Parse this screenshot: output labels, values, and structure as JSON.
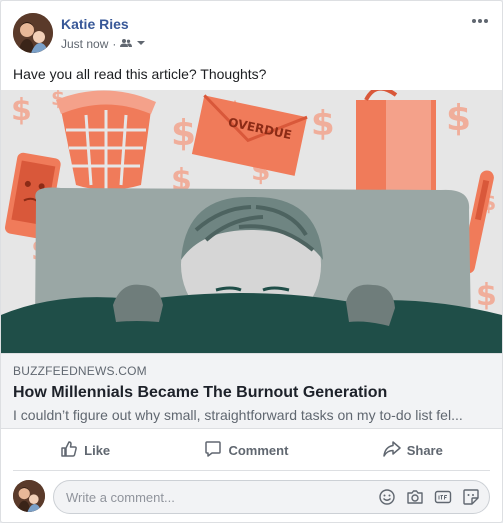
{
  "post": {
    "author": "Katie Ries",
    "timestamp": "Just now",
    "separator": "·",
    "audience_icon": "friends-icon",
    "text": "Have you all read this article? Thoughts?"
  },
  "illustration": {
    "overdue_label": "OVERDUE"
  },
  "link": {
    "domain": "BUZZFEEDNEWS.COM",
    "title": "How Millennials Became The Burnout Generation",
    "description": "I couldn’t figure out why small, straightforward tasks on my to-do list fel..."
  },
  "actions": {
    "like": "Like",
    "comment": "Comment",
    "share": "Share"
  },
  "comment_box": {
    "placeholder": "Write a comment...",
    "icons": [
      "emoji-icon",
      "camera-icon",
      "gif-icon",
      "sticker-icon"
    ]
  },
  "colors": {
    "author_blue": "#385898",
    "muted_text": "#606770",
    "illustration_bg": "#eaeaea",
    "accent_orange": "#f07b5a",
    "blanket_green": "#1f4e48"
  }
}
